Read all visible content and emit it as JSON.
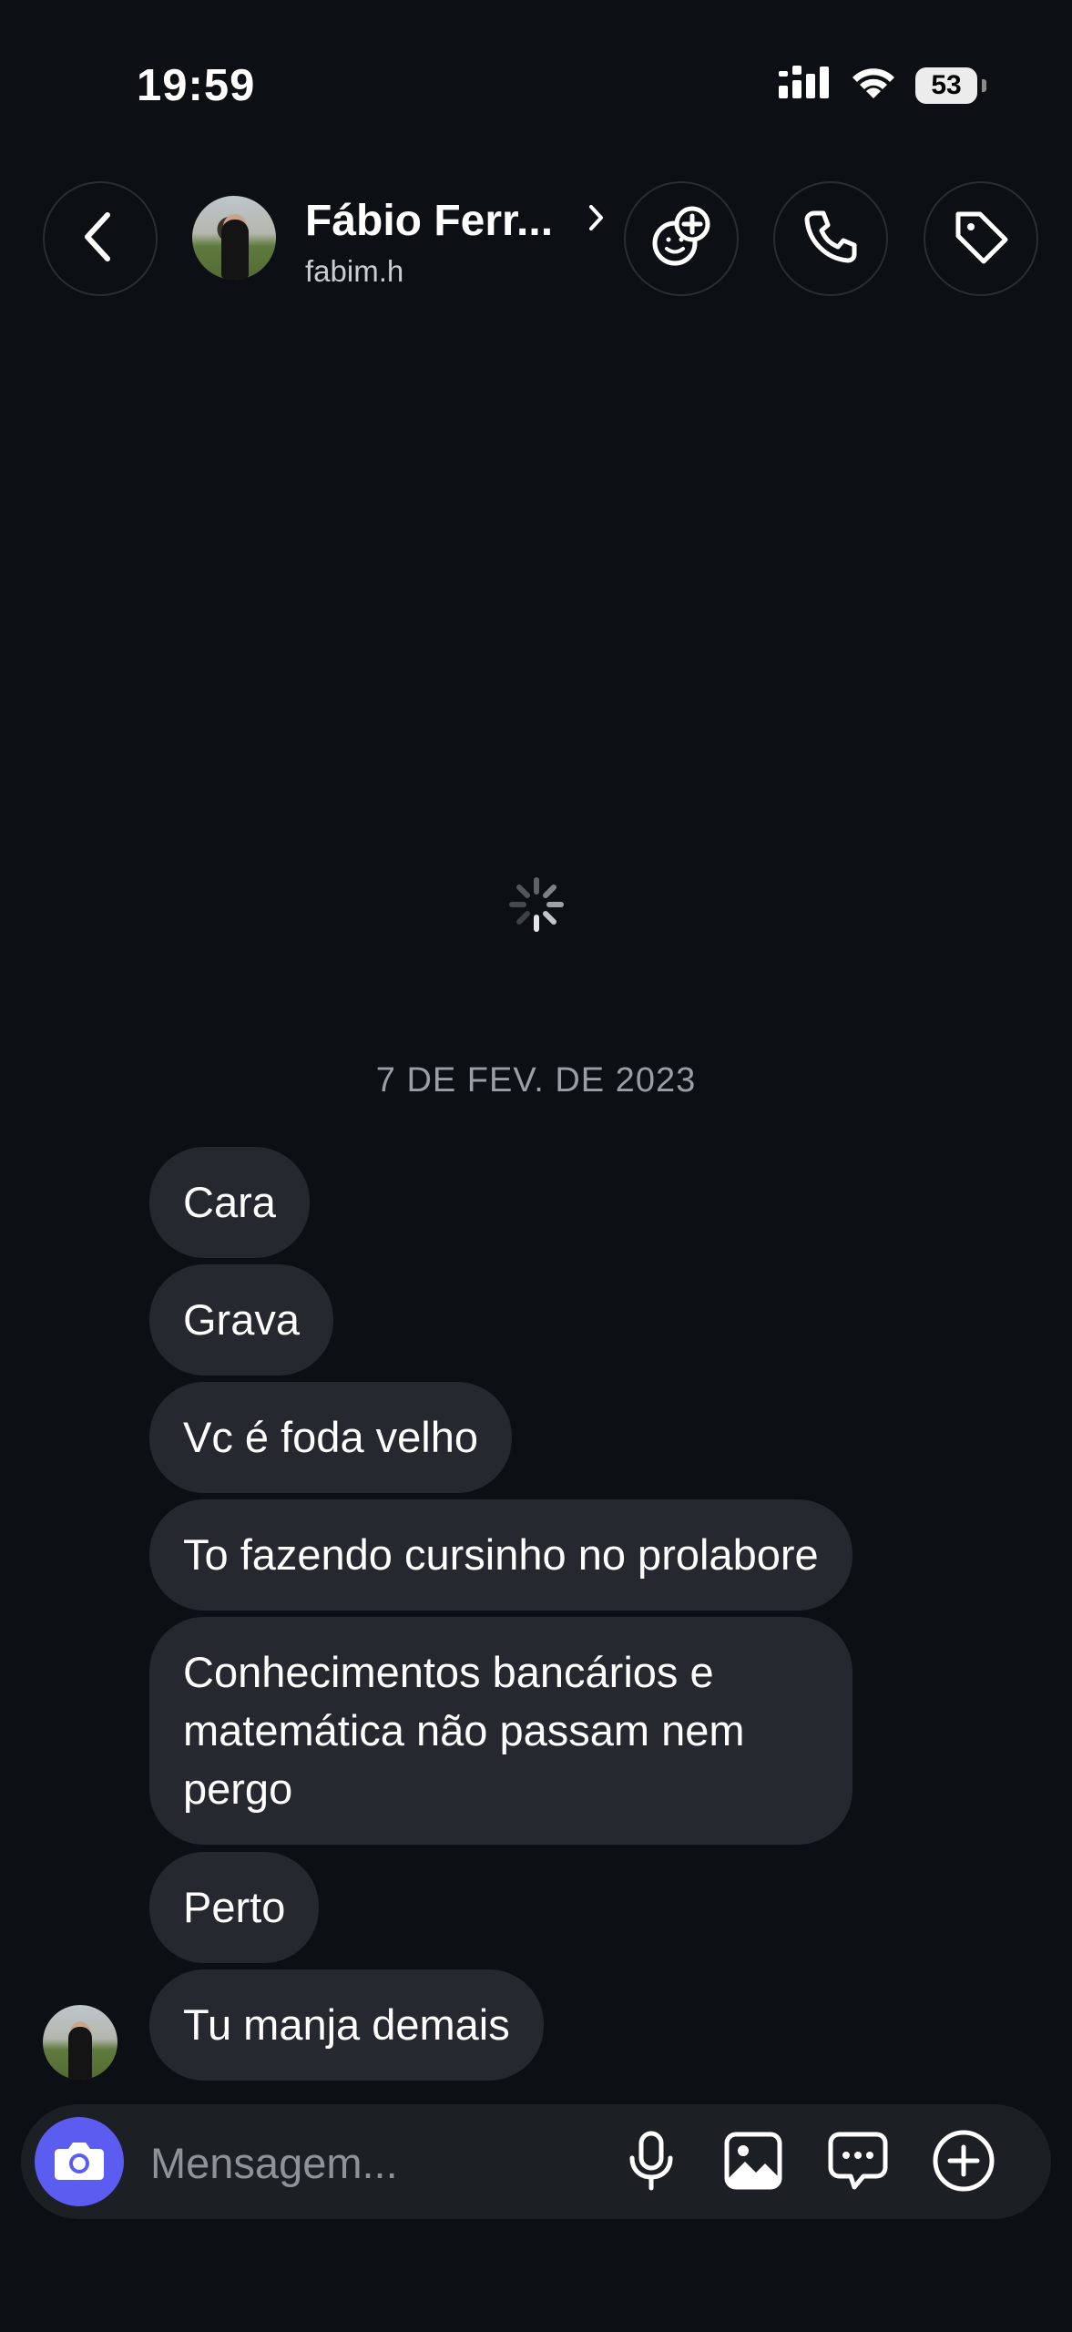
{
  "status_bar": {
    "time": "19:59",
    "battery": "53",
    "icons": [
      "signal-icon",
      "wifi-icon",
      "battery-icon"
    ]
  },
  "header": {
    "contact_name": "Fábio Ferr...",
    "contact_handle": "fabim.h",
    "icons": [
      "back-arrow-icon",
      "chevron-right-icon",
      "add-friend-icon",
      "phone-icon",
      "tag-icon"
    ]
  },
  "conversation": {
    "date": "7 DE FEV. DE 2023",
    "messages": [
      {
        "text": "Cara"
      },
      {
        "text": "Grava"
      },
      {
        "text": "Vc é foda velho"
      },
      {
        "text": "To fazendo cursinho no prolabore"
      },
      {
        "text": "Conhecimentos bancários e matemática não passam nem pergo"
      },
      {
        "text": "Perto"
      },
      {
        "text": "Tu manja demais"
      }
    ]
  },
  "composer": {
    "placeholder": "Mensagem...",
    "icons": [
      "camera-icon",
      "microphone-icon",
      "gallery-icon",
      "sticker-icon",
      "plus-icon"
    ]
  },
  "colors": {
    "background": "#0c0f14",
    "bubble": "#25282e",
    "accent": "#5b5cf0"
  }
}
